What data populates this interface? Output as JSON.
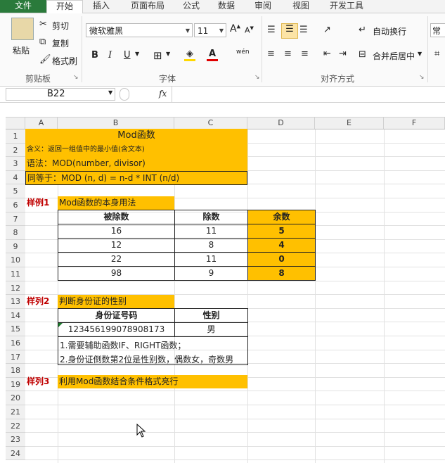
{
  "tabs": [
    "文件",
    "开始",
    "插入",
    "页面布局",
    "公式",
    "数据",
    "审阅",
    "视图",
    "开发工具"
  ],
  "ribbon": {
    "paste": "粘贴",
    "cut": "剪切",
    "copy": "复制",
    "format_painter": "格式刷",
    "clipboard_label": "剪贴板",
    "font_name": "微软雅黑",
    "font_size": "11",
    "font_label": "字体",
    "wrap_text": "自动换行",
    "merge_center": "合并后居中",
    "alignment_label": "对齐方式",
    "number_format": "常规",
    "grow_font": "A",
    "shrink_font": "A",
    "bold": "B",
    "italic": "I",
    "underline": "U",
    "phonetic": "wén"
  },
  "formula_bar": {
    "name_box": "B22",
    "fx": "fx",
    "formula": ""
  },
  "columns": [
    "A",
    "B",
    "C",
    "D",
    "E",
    "F"
  ],
  "rows": [
    "1",
    "2",
    "3",
    "4",
    "5",
    "6",
    "7",
    "8",
    "9",
    "10",
    "11",
    "12",
    "13",
    "14",
    "15",
    "16",
    "17",
    "18",
    "19",
    "20",
    "21",
    "22",
    "23",
    "24"
  ],
  "sheet": {
    "title": "Mod函数",
    "meaning": "含义：返回一组值中的最小值(含文本)",
    "syntax": "语法：MOD(number, divisor)",
    "equivalent": "同等于：MOD (n, d) = n-d * INT (n/d)",
    "ex1_label": "样例1",
    "ex1_title": "Mod函数的本身用法",
    "ex1_headers": [
      "被除数",
      "除数",
      "余数"
    ],
    "ex1_rows": [
      {
        "dividend": "16",
        "divisor": "11",
        "remainder": "5"
      },
      {
        "dividend": "12",
        "divisor": "8",
        "remainder": "4"
      },
      {
        "dividend": "22",
        "divisor": "11",
        "remainder": "0"
      },
      {
        "dividend": "98",
        "divisor": "9",
        "remainder": "8"
      }
    ],
    "ex2_label": "样列2",
    "ex2_title": "判断身份证的性别",
    "ex2_headers": [
      "身份证号码",
      "性别"
    ],
    "ex2_id": "123456199078908173",
    "ex2_gender": "男",
    "ex2_note1": "1.需要辅助函数IF、RIGHT函数；",
    "ex2_note2": "2.身份证倒数第2位是性别数，偶数女，奇数男",
    "ex3_label": "样列3",
    "ex3_title": "利用Mod函数结合条件格式亮行"
  }
}
